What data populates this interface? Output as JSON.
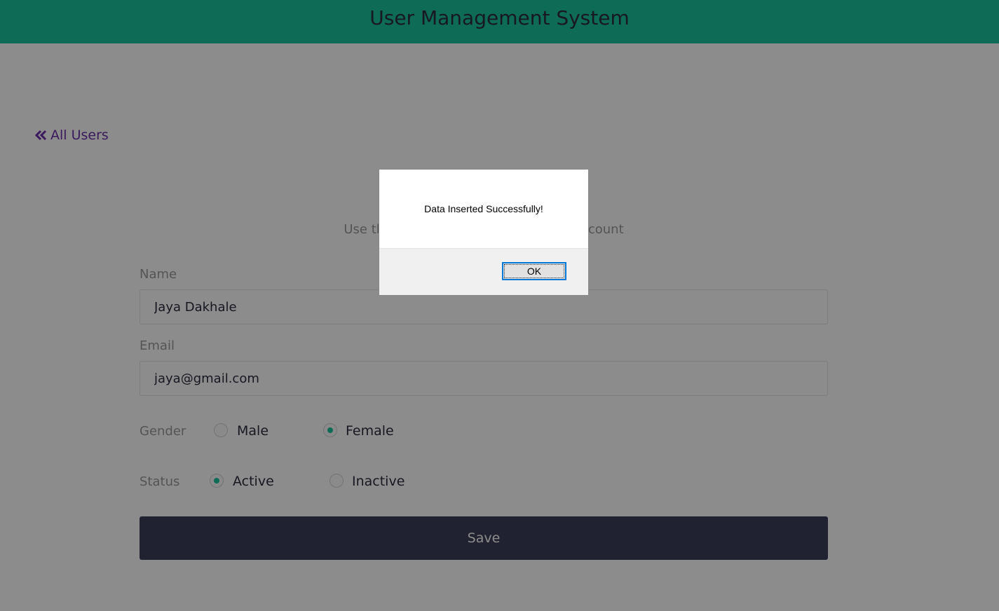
{
  "header": {
    "title": "User Management System"
  },
  "nav": {
    "back_label": "All Users"
  },
  "form": {
    "subtitle": "Use the below form to create a new account",
    "name": {
      "label": "Name",
      "value": "Jaya Dakhale"
    },
    "email": {
      "label": "Email",
      "value": "jaya@gmail.com"
    },
    "gender": {
      "label": "Gender",
      "options": [
        {
          "label": "Male",
          "checked": false
        },
        {
          "label": "Female",
          "checked": true
        }
      ]
    },
    "status": {
      "label": "Status",
      "options": [
        {
          "label": "Active",
          "checked": true
        },
        {
          "label": "Inactive",
          "checked": false
        }
      ]
    },
    "save_label": "Save"
  },
  "dialog": {
    "message": "Data Inserted Successfully!",
    "ok_label": "OK"
  },
  "colors": {
    "header_bg": "#1bc49c",
    "accent": "#1bc49c",
    "link": "#6a2fa8",
    "button_bg": "#3b3c5a"
  }
}
